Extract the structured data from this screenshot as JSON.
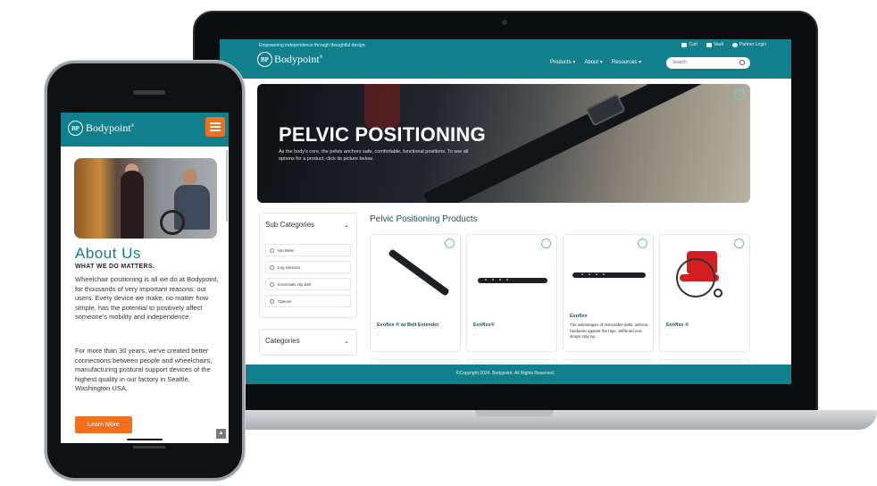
{
  "colors": {
    "brand_teal": "#127f8c",
    "accent_orange": "#f26f1e",
    "heading_navy": "#1d4f5e"
  },
  "laptop": {
    "tagline": "Empowering independence through thoughtful design.",
    "top_links": {
      "cart": "Cart",
      "vault": "Vault",
      "partner": "Partner Login"
    },
    "logo": {
      "mark": "BP",
      "text": "Bodypoint"
    },
    "nav": [
      "Products",
      "About",
      "Resources"
    ],
    "search_placeholder": "Search",
    "hero": {
      "title": "PELVIC POSITIONING",
      "description": "As the body's core, the pelvis anchors safe, comfortable, functional positions. To see all options for a product, click its picture below."
    },
    "filters": {
      "sub_categories_label": "Sub Categories",
      "options": [
        "Hip Belts",
        "Leg Harness",
        "Essentials Hip Belt",
        "Options"
      ],
      "categories_label": "Categories"
    },
    "products_heading": "Pelvic Positioning Products",
    "products": [
      {
        "name": "Evoflex ® w/ Belt Extender",
        "desc": "..."
      },
      {
        "name": "Evoflex®",
        "desc": "..."
      },
      {
        "name": "Evoflex",
        "desc": "The advantages of retractable belts, without hardware against the hips. Stiffened end straps stay up...."
      },
      {
        "name": "Evoflex ®",
        "desc": "..."
      }
    ],
    "footer": "©Copyright 2024. Bodypoint. All Rights Reserved."
  },
  "phone": {
    "logo": {
      "mark": "BP",
      "text": "Bodypoint"
    },
    "title": "About Us",
    "subtitle": "WHAT WE DO MATTERS.",
    "para1": "Wheelchair positioning is all we do at Bodypoint, for thousands of very important reasons: our users. Every device we make, no matter how simple, has the potential to positively affect someone's mobility and independence.",
    "para2": "For more than 30 years, we've created better connections between people and wheelchairs, manufacturing postural support devices of the highest quality in our factory in Seattle, Washington USA.",
    "button": "Learn More"
  }
}
